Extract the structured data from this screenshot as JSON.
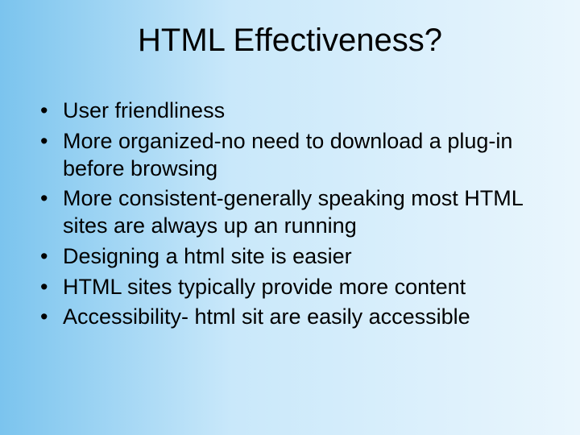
{
  "slide": {
    "title": "HTML Effectiveness?",
    "bullets": [
      "User friendliness",
      "More organized-no need to download a plug-in before browsing",
      "More consistent-generally speaking most HTML sites are always up an running",
      "Designing a html site is easier",
      "HTML sites typically provide more content",
      "Accessibility- html sit are easily accessible"
    ]
  }
}
